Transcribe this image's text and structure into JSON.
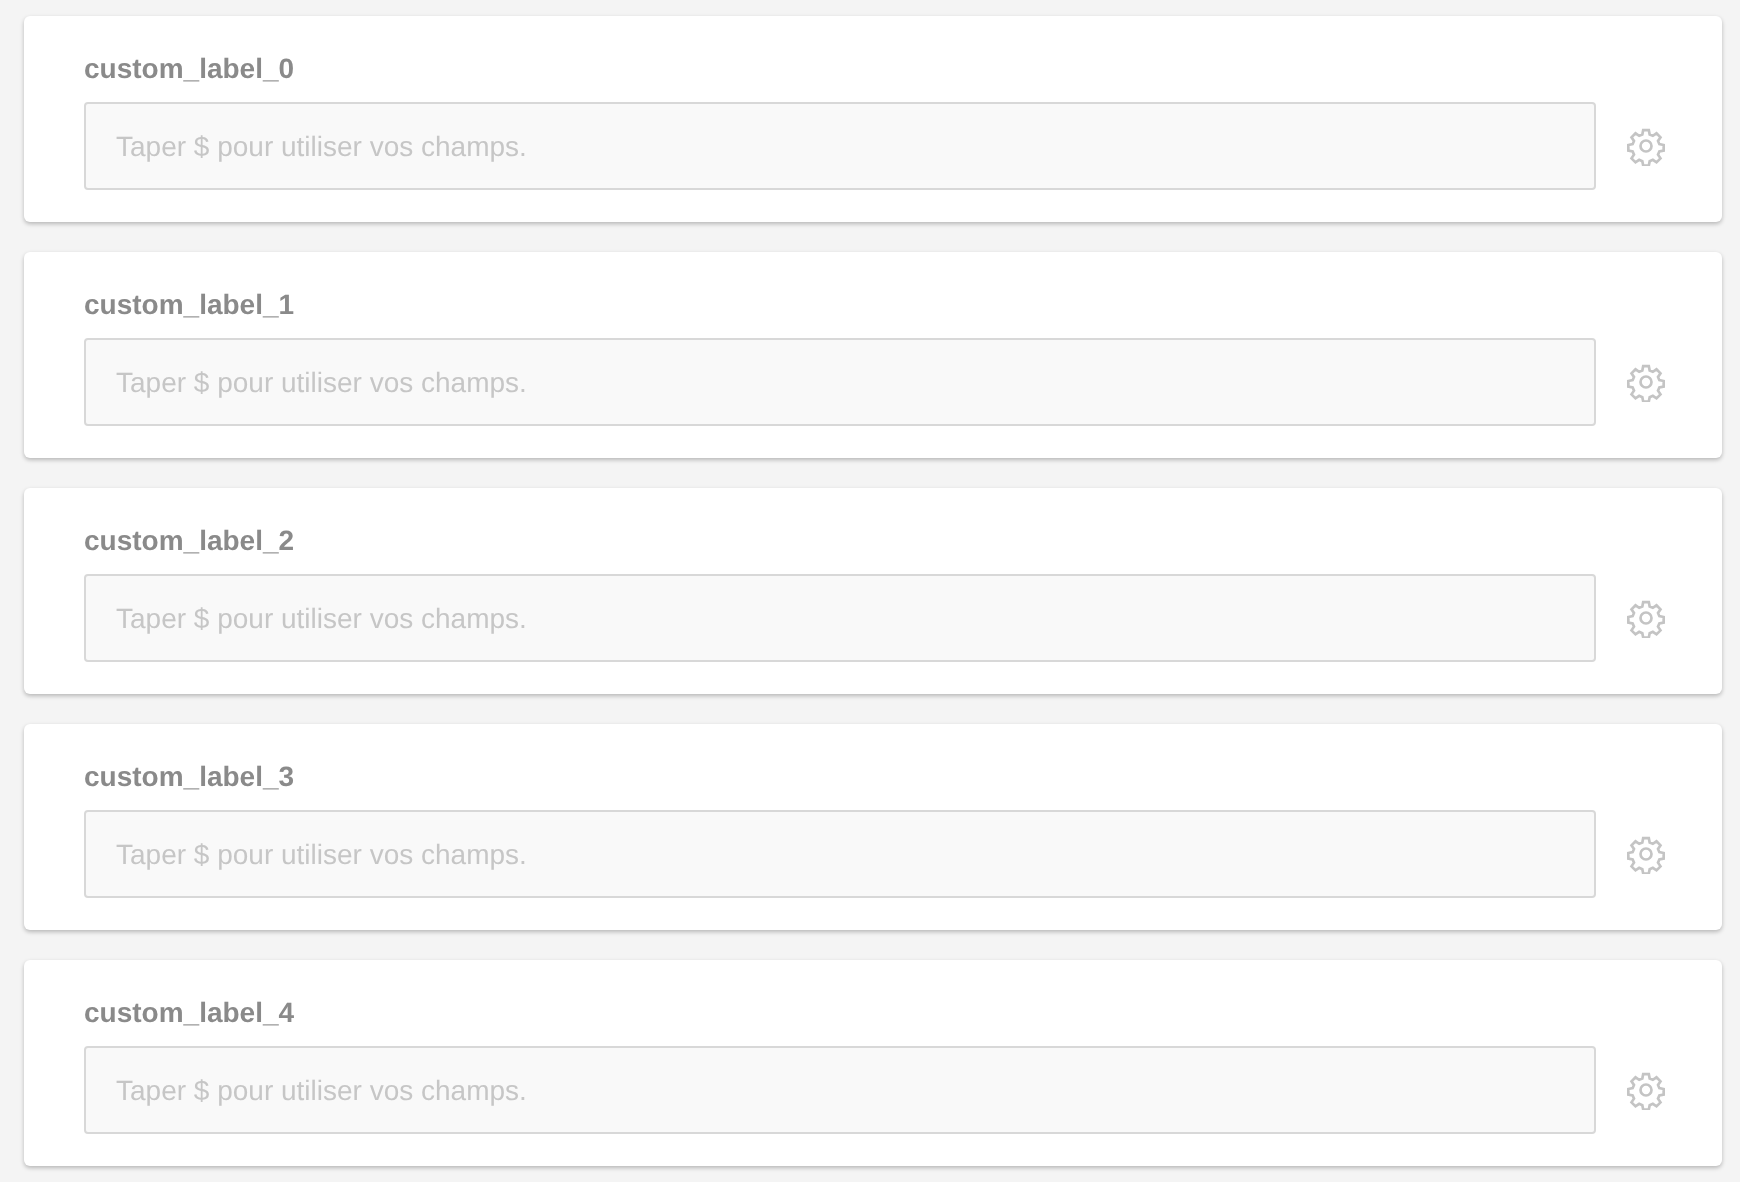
{
  "fields": [
    {
      "label": "custom_label_0",
      "placeholder": "Taper $ pour utiliser vos champs."
    },
    {
      "label": "custom_label_1",
      "placeholder": "Taper $ pour utiliser vos champs."
    },
    {
      "label": "custom_label_2",
      "placeholder": "Taper $ pour utiliser vos champs."
    },
    {
      "label": "custom_label_3",
      "placeholder": "Taper $ pour utiliser vos champs."
    },
    {
      "label": "custom_label_4",
      "placeholder": "Taper $ pour utiliser vos champs."
    }
  ]
}
